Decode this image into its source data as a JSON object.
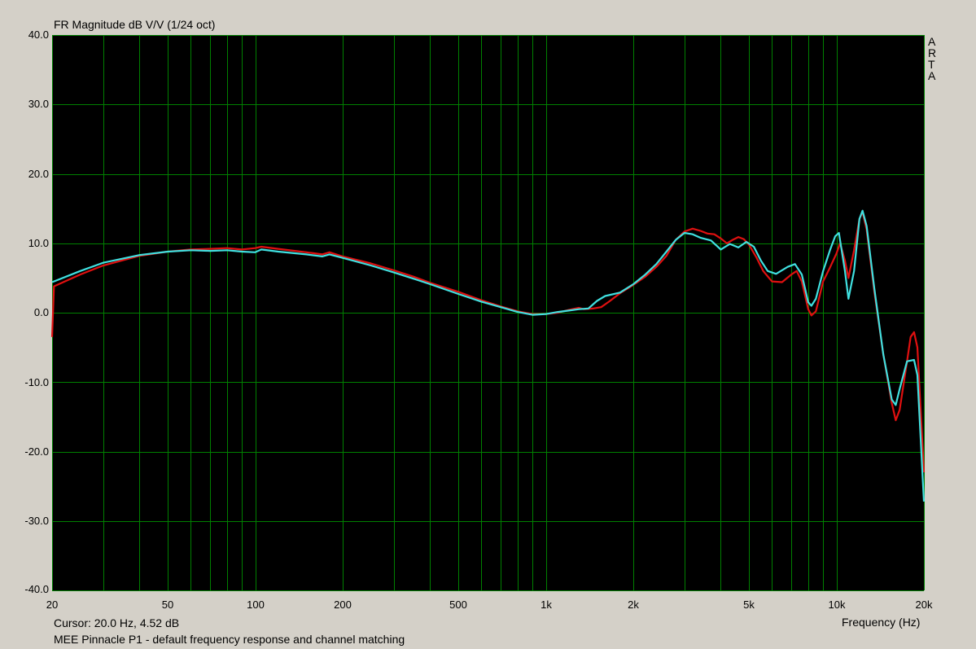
{
  "header": {
    "title": "FR Magnitude dB V/V (1/24 oct)",
    "brand": [
      "A",
      "R",
      "T",
      "A"
    ]
  },
  "footer": {
    "cursor": "Cursor: 20.0 Hz, 4.52 dB",
    "caption": "MEE Pinnacle P1 - default frequency response and channel matching",
    "xaxis_name": "Frequency (Hz)"
  },
  "colors": {
    "background": "#000000",
    "grid": "#008000",
    "frame": "#d4d0c8",
    "left_channel": "#e01010",
    "right_channel": "#40e0e0"
  },
  "chart_data": {
    "type": "line",
    "title": "FR Magnitude dB V/V (1/24 oct)",
    "xlabel": "Frequency (Hz)",
    "ylabel": "",
    "xscale": "log",
    "xlim": [
      20,
      20000
    ],
    "ylim": [
      -40,
      40
    ],
    "grid": true,
    "y_ticks": [
      40,
      30,
      20,
      10,
      0,
      -10,
      -20,
      -30,
      -40
    ],
    "y_tick_labels": [
      "40.0",
      "30.0",
      "20.0",
      "10.0",
      "0.0",
      "-10.0",
      "-20.0",
      "-30.0",
      "-40.0"
    ],
    "x_ticks": [
      20,
      50,
      100,
      200,
      500,
      1000,
      2000,
      5000,
      10000,
      20000
    ],
    "x_tick_labels": [
      "20",
      "50",
      "100",
      "200",
      "500",
      "1k",
      "2k",
      "5k",
      "10k",
      "20k"
    ],
    "series": [
      {
        "color": "#e01010",
        "points": [
          [
            20,
            -3.5
          ],
          [
            20.3,
            3.8
          ],
          [
            25,
            5.5
          ],
          [
            30,
            6.8
          ],
          [
            40,
            8.2
          ],
          [
            50,
            8.8
          ],
          [
            60,
            9.1
          ],
          [
            70,
            9.2
          ],
          [
            80,
            9.3
          ],
          [
            90,
            9.1
          ],
          [
            100,
            9.3
          ],
          [
            105,
            9.5
          ],
          [
            120,
            9.2
          ],
          [
            150,
            8.7
          ],
          [
            170,
            8.4
          ],
          [
            180,
            8.7
          ],
          [
            200,
            8.1
          ],
          [
            250,
            7.1
          ],
          [
            300,
            6.1
          ],
          [
            350,
            5.2
          ],
          [
            400,
            4.3
          ],
          [
            500,
            3.0
          ],
          [
            600,
            1.8
          ],
          [
            700,
            0.9
          ],
          [
            800,
            0.2
          ],
          [
            900,
            -0.2
          ],
          [
            1000,
            -0.2
          ],
          [
            1100,
            0.0
          ],
          [
            1200,
            0.4
          ],
          [
            1300,
            0.7
          ],
          [
            1350,
            0.5
          ],
          [
            1450,
            0.6
          ],
          [
            1550,
            0.8
          ],
          [
            1650,
            1.6
          ],
          [
            1800,
            2.8
          ],
          [
            2000,
            4.0
          ],
          [
            2200,
            5.2
          ],
          [
            2400,
            6.6
          ],
          [
            2600,
            8.2
          ],
          [
            2800,
            10.5
          ],
          [
            3000,
            11.7
          ],
          [
            3200,
            12.1
          ],
          [
            3400,
            11.8
          ],
          [
            3600,
            11.4
          ],
          [
            3800,
            11.3
          ],
          [
            4000,
            10.7
          ],
          [
            4200,
            10.0
          ],
          [
            4400,
            10.5
          ],
          [
            4600,
            10.9
          ],
          [
            4800,
            10.6
          ],
          [
            5000,
            9.8
          ],
          [
            5300,
            8.0
          ],
          [
            5600,
            6.0
          ],
          [
            6000,
            4.5
          ],
          [
            6500,
            4.4
          ],
          [
            7000,
            5.5
          ],
          [
            7300,
            6.0
          ],
          [
            7600,
            4.5
          ],
          [
            8000,
            0.5
          ],
          [
            8200,
            -0.4
          ],
          [
            8500,
            0.2
          ],
          [
            9000,
            4.5
          ],
          [
            9500,
            6.5
          ],
          [
            10000,
            8.5
          ],
          [
            10300,
            10.0
          ],
          [
            10700,
            7.5
          ],
          [
            11000,
            5.0
          ],
          [
            11500,
            9.0
          ],
          [
            12000,
            13.5
          ],
          [
            12300,
            14.5
          ],
          [
            12700,
            12.0
          ],
          [
            13500,
            3.0
          ],
          [
            14500,
            -6.0
          ],
          [
            15500,
            -13.0
          ],
          [
            16000,
            -15.5
          ],
          [
            16500,
            -14.0
          ],
          [
            17500,
            -7.0
          ],
          [
            18000,
            -3.5
          ],
          [
            18500,
            -2.8
          ],
          [
            19000,
            -5.0
          ],
          [
            20000,
            -23.0
          ]
        ]
      },
      {
        "color": "#40e0e0",
        "points": [
          [
            20,
            4.4
          ],
          [
            25,
            6.0
          ],
          [
            30,
            7.2
          ],
          [
            40,
            8.3
          ],
          [
            50,
            8.8
          ],
          [
            60,
            9.0
          ],
          [
            70,
            8.9
          ],
          [
            80,
            9.0
          ],
          [
            90,
            8.8
          ],
          [
            100,
            8.7
          ],
          [
            105,
            9.1
          ],
          [
            120,
            8.8
          ],
          [
            150,
            8.4
          ],
          [
            170,
            8.1
          ],
          [
            180,
            8.4
          ],
          [
            200,
            7.9
          ],
          [
            250,
            6.8
          ],
          [
            300,
            5.8
          ],
          [
            350,
            4.9
          ],
          [
            400,
            4.1
          ],
          [
            500,
            2.7
          ],
          [
            600,
            1.6
          ],
          [
            700,
            0.8
          ],
          [
            800,
            0.1
          ],
          [
            900,
            -0.3
          ],
          [
            1000,
            -0.2
          ],
          [
            1100,
            0.1
          ],
          [
            1200,
            0.3
          ],
          [
            1300,
            0.5
          ],
          [
            1400,
            0.6
          ],
          [
            1500,
            1.7
          ],
          [
            1600,
            2.4
          ],
          [
            1800,
            2.9
          ],
          [
            2000,
            4.1
          ],
          [
            2200,
            5.5
          ],
          [
            2400,
            7.0
          ],
          [
            2600,
            8.8
          ],
          [
            2800,
            10.5
          ],
          [
            3000,
            11.5
          ],
          [
            3200,
            11.3
          ],
          [
            3400,
            10.8
          ],
          [
            3700,
            10.4
          ],
          [
            4000,
            9.1
          ],
          [
            4300,
            9.9
          ],
          [
            4600,
            9.4
          ],
          [
            4900,
            10.2
          ],
          [
            5200,
            9.5
          ],
          [
            5500,
            7.5
          ],
          [
            5800,
            6.0
          ],
          [
            6200,
            5.6
          ],
          [
            6800,
            6.6
          ],
          [
            7200,
            7.0
          ],
          [
            7600,
            5.5
          ],
          [
            8000,
            1.5
          ],
          [
            8200,
            1.0
          ],
          [
            8500,
            2.0
          ],
          [
            9000,
            6.0
          ],
          [
            9500,
            9.0
          ],
          [
            9900,
            11.0
          ],
          [
            10200,
            11.5
          ],
          [
            10700,
            6.0
          ],
          [
            11000,
            2.0
          ],
          [
            11500,
            6.0
          ],
          [
            12000,
            13.5
          ],
          [
            12300,
            14.7
          ],
          [
            12700,
            12.5
          ],
          [
            13500,
            3.5
          ],
          [
            14500,
            -6.0
          ],
          [
            15500,
            -12.5
          ],
          [
            16000,
            -13.3
          ],
          [
            16500,
            -11.0
          ],
          [
            17500,
            -7.0
          ],
          [
            18500,
            -6.8
          ],
          [
            19000,
            -9.0
          ],
          [
            20000,
            -27.2
          ]
        ]
      }
    ]
  }
}
